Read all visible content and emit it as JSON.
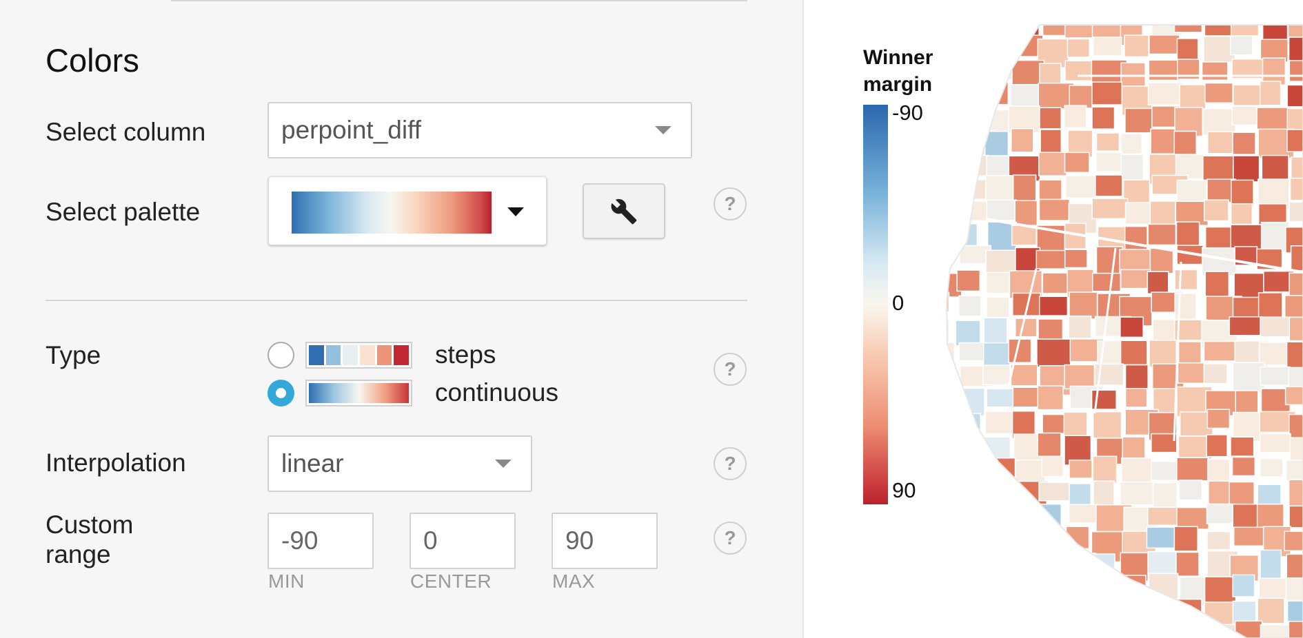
{
  "colors_section": {
    "title": "Colors",
    "select_column": {
      "label": "Select column",
      "value": "perpoint_diff"
    },
    "select_palette": {
      "label": "Select palette"
    },
    "type": {
      "label": "Type",
      "options": [
        {
          "label": "steps",
          "selected": false,
          "swatches": [
            "#2f6fb1",
            "#93c0df",
            "#e7eef2",
            "#fbe1d1",
            "#ee9478",
            "#c22734"
          ]
        },
        {
          "label": "continuous",
          "selected": true
        }
      ]
    },
    "interpolation": {
      "label": "Interpolation",
      "value": "linear"
    },
    "custom_range": {
      "label_line1": "Custom",
      "label_line2": "range",
      "min": "-90",
      "center": "0",
      "max": "90",
      "min_caption": "MIN",
      "center_caption": "CENTER",
      "max_caption": "MAX"
    },
    "help_glyph": "?"
  },
  "legend": {
    "title_line1": "Winner",
    "title_line2": "margin",
    "top": "-90",
    "middle": "0",
    "bottom": "90"
  },
  "colors": {
    "accent": "#34a8d6",
    "palette_low": "#2f6fb1",
    "palette_mid": "#f7f6ef",
    "palette_high": "#c22734"
  },
  "icons": {
    "settings_button": "wrench-icon",
    "dropdown": "triangle-down",
    "help": "question-mark"
  }
}
